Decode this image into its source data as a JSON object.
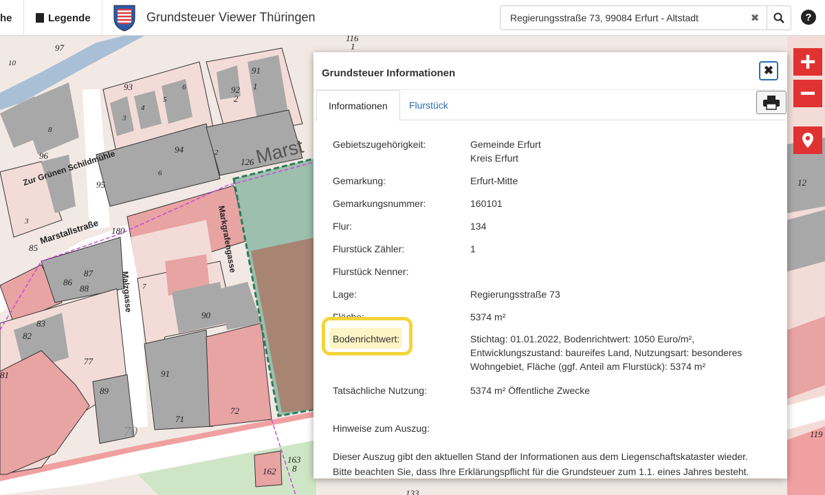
{
  "topbar": {
    "left_cut_label": "he",
    "legend_label": "Legende",
    "app_title": "Grundsteuer Viewer Thüringen",
    "search_value": "Regierungsstraße 73, 99084 Erfurt - Altstadt",
    "help_label": "?"
  },
  "map": {
    "street_labels": [
      "Marstallstraße",
      "Zur Grünen Schildmühle",
      "Markgrafengasse",
      "Malzgasse",
      "Marst"
    ],
    "parcel_numbers": [
      "97",
      "93",
      "92",
      "2",
      "91",
      "1",
      "4",
      "5",
      "6",
      "3",
      "96",
      "94",
      "95",
      "126",
      "180",
      "85",
      "87",
      "86",
      "88",
      "83",
      "82",
      "77",
      "89",
      "81",
      "91",
      "90",
      "72",
      "71",
      "70",
      "163",
      "8",
      "162",
      "116",
      "1",
      "12",
      "119",
      "133",
      "7",
      "3",
      "10",
      "6",
      "8",
      "2"
    ],
    "colors": {
      "road": "#ffffff",
      "pink": "#e8a3a3",
      "pink_light": "#f3dcd8",
      "gray": "#a8a8a8",
      "green_parcel": "#9dbfae",
      "brown": "#a88473",
      "selection": "#2e7a5a",
      "boundary": "#c84bd8"
    }
  },
  "controls": {
    "zoom_in": "+",
    "zoom_out": "−"
  },
  "dialog": {
    "title": "Grundsteuer Informationen",
    "close_symbol": "✖",
    "tabs": [
      "Informationen",
      "Flurstück"
    ],
    "rows": [
      {
        "label": "Gebietszugehörigkeit:",
        "value_lines": [
          "Gemeinde Erfurt",
          "Kreis Erfurt"
        ]
      },
      {
        "label": "Gemarkung:",
        "value_lines": [
          "Erfurt-Mitte"
        ]
      },
      {
        "label": "Gemarkungsnummer:",
        "value_lines": [
          "160101"
        ]
      },
      {
        "label": "Flur:",
        "value_lines": [
          "134"
        ]
      },
      {
        "label": "Flurstück Zähler:",
        "value_lines": [
          "1"
        ]
      },
      {
        "label": "Flurstück Nenner:",
        "value_lines": [
          ""
        ]
      },
      {
        "label": "Lage:",
        "value_lines": [
          "Regierungsstraße 73"
        ]
      },
      {
        "label": "Fläche:",
        "value_lines": [
          "5374 m²"
        ]
      },
      {
        "label": "Bodenrichtwert:",
        "value_lines": [
          "Stichtag: 01.01.2022, Bodenrichtwert: 1050 Euro/m²,",
          "Entwicklungszustand: baureifes Land, Nutzungsart: besonderes",
          "Wohngebiet, Fläche (ggf. Anteil am Flurstück): 5374 m²"
        ]
      },
      {
        "label": "Tatsächliche Nutzung:",
        "value_lines": [
          "5374 m² Öffentliche Zwecke"
        ]
      }
    ],
    "notes_heading": "Hinweise zum Auszug:",
    "notes_lines": [
      "Dieser Auszug gibt den aktuellen Stand der Informationen aus dem Liegenschaftskataster wieder.",
      "Bitte beachten Sie, dass Ihre Erklärungspflicht für die Grundsteuer zum 1.1. eines Jahres besteht."
    ]
  }
}
